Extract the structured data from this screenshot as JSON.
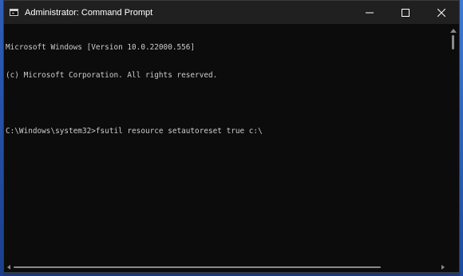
{
  "window": {
    "title": "Administrator: Command Prompt",
    "icon": "command-prompt-icon"
  },
  "controls": {
    "minimize_icon": "minimize-icon",
    "maximize_icon": "maximize-icon",
    "close_icon": "close-icon"
  },
  "console": {
    "lines": [
      "Microsoft Windows [Version 10.0.22000.556]",
      "(c) Microsoft Corporation. All rights reserved.",
      "",
      "C:\\Windows\\system32>fsutil resource setautoreset true c:\\"
    ],
    "text_color": "#cccccc",
    "background_color": "#0c0c0c"
  },
  "theme": {
    "titlebar_color": "#202020",
    "titlebar_text_color": "#ffffff"
  }
}
